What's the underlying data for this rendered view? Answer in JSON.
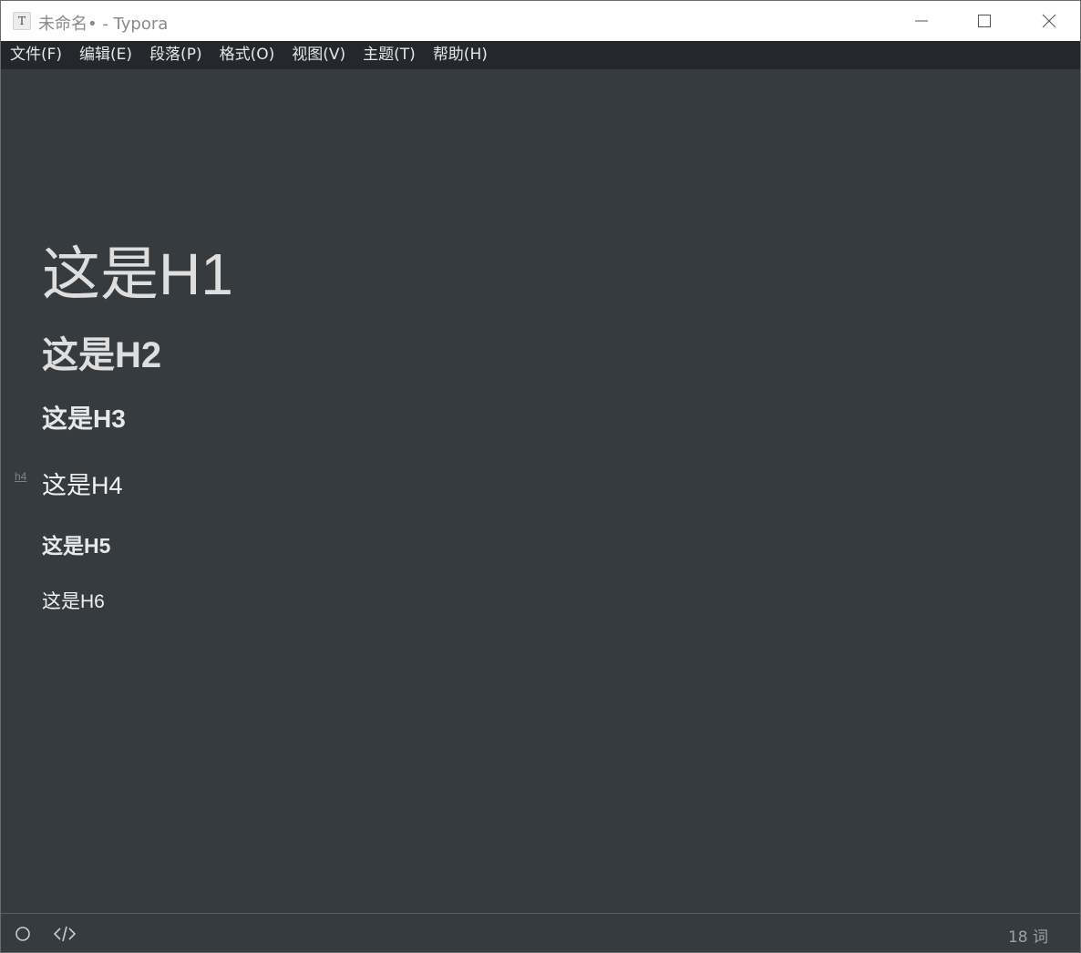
{
  "window": {
    "title": "未命名• - Typora",
    "app_icon_letter": "T"
  },
  "menu": {
    "items": [
      {
        "label": "文件(F)"
      },
      {
        "label": "编辑(E)"
      },
      {
        "label": "段落(P)"
      },
      {
        "label": "格式(O)"
      },
      {
        "label": "视图(V)"
      },
      {
        "label": "主题(T)"
      },
      {
        "label": "帮助(H)"
      }
    ]
  },
  "document": {
    "headings": [
      {
        "level": "h1",
        "text": "这是H1"
      },
      {
        "level": "h2",
        "text": "这是H2"
      },
      {
        "level": "h3",
        "text": "这是H3"
      },
      {
        "level": "h4",
        "text": "这是H4"
      },
      {
        "level": "h5",
        "text": "这是H5"
      },
      {
        "level": "h6",
        "text": "这是H6"
      }
    ],
    "active_block_marker": "h4"
  },
  "statusbar": {
    "outline_icon": "circle-outline-icon",
    "source_icon": "code-brackets-icon",
    "word_count": "18 词"
  },
  "colors": {
    "editor_bg": "#363b40",
    "menubar_bg": "#24282c",
    "text": "#e6e6e6"
  }
}
